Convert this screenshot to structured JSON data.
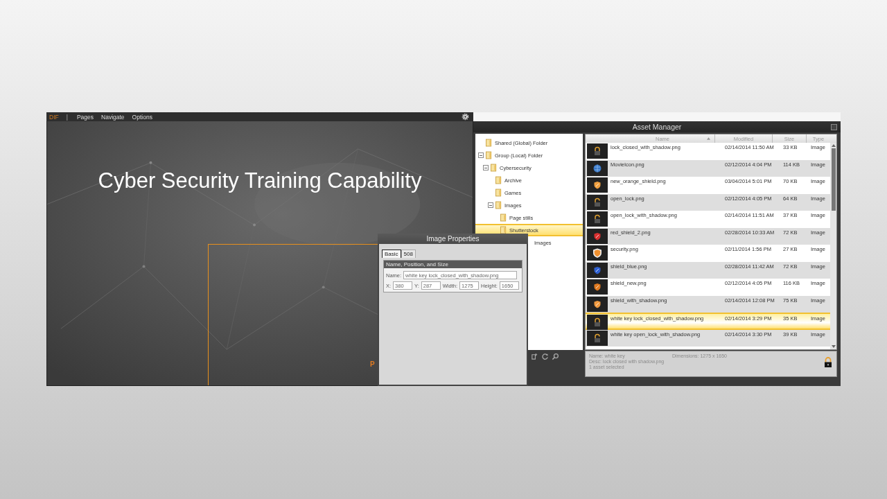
{
  "editor": {
    "menu": {
      "logo": "DIF",
      "separator": "|",
      "items": [
        "Pages",
        "Navigate",
        "Options"
      ]
    },
    "slide": {
      "title": "Cyber Security Training Capability",
      "partial_text": "P"
    }
  },
  "asset_manager": {
    "title": "Asset Manager",
    "tree": [
      {
        "label": "Shared (Global) Folder",
        "selected": false
      },
      {
        "label": "Group (Local) Folder",
        "expanded": true,
        "selected": false,
        "children": [
          {
            "label": "Cybersecurity",
            "expanded": true,
            "selected": false,
            "children": [
              {
                "label": "Archive",
                "selected": false
              },
              {
                "label": "Games",
                "selected": false
              },
              {
                "label": "Images",
                "expanded": true,
                "selected": false,
                "children": [
                  {
                    "label": "Page stills",
                    "selected": false
                  },
                  {
                    "label": "Shutterstock",
                    "selected": true
                  },
                  {
                    "label": "Images",
                    "selected": false,
                    "partly_hidden": true
                  }
                ]
              }
            ]
          }
        ]
      }
    ],
    "columns": [
      {
        "label": "Name",
        "sorted": true
      },
      {
        "label": "Modified",
        "sorted": false
      },
      {
        "label": "Size",
        "sorted": false
      },
      {
        "label": "Type",
        "sorted": false
      }
    ],
    "rows": [
      {
        "kind": "lock-closed",
        "name": "lock_closed_with_shadow.png",
        "modified": "02/14/2014 11:50 AM",
        "size": "33 KB",
        "type": "Image",
        "selected": false
      },
      {
        "kind": "globe",
        "name": "MovieIcon.png",
        "modified": "02/12/2014 4:04 PM",
        "size": "114 KB",
        "type": "Image",
        "selected": false
      },
      {
        "kind": "shield",
        "color": "#f0a040",
        "name": "new_orange_shield.png",
        "modified": "03/04/2014 5:01 PM",
        "size": "70 KB",
        "type": "Image",
        "selected": false
      },
      {
        "kind": "lock-open",
        "name": "open_lock.png",
        "modified": "02/12/2014 4:05 PM",
        "size": "64 KB",
        "type": "Image",
        "selected": false
      },
      {
        "kind": "lock-open",
        "name": "open_lock_with_shadow.png",
        "modified": "02/14/2014 11:51 AM",
        "size": "37 KB",
        "type": "Image",
        "selected": false
      },
      {
        "kind": "shield",
        "color": "#d83030",
        "name": "red_shield_2.png",
        "modified": "02/28/2014 10:33 AM",
        "size": "72 KB",
        "type": "Image",
        "selected": false
      },
      {
        "kind": "shield-large",
        "color": "#f09030",
        "name": "security.png",
        "modified": "02/11/2014 1:56 PM",
        "size": "27 KB",
        "type": "Image",
        "selected": false
      },
      {
        "kind": "shield",
        "color": "#3060d0",
        "name": "shield_blue.png",
        "modified": "02/28/2014 11:42 AM",
        "size": "72 KB",
        "type": "Image",
        "selected": false
      },
      {
        "kind": "shield",
        "color": "#e07a20",
        "name": "shield_new.png",
        "modified": "02/12/2014 4:05 PM",
        "size": "116 KB",
        "type": "Image",
        "selected": false
      },
      {
        "kind": "shield",
        "color": "#f09a40",
        "name": "shield_with_shadow.png",
        "modified": "02/14/2014 12:08 PM",
        "size": "75 KB",
        "type": "Image",
        "selected": false
      },
      {
        "kind": "lock-closed",
        "name": "white key lock_closed_with_shadow.png",
        "modified": "02/14/2014 3:29 PM",
        "size": "35 KB",
        "type": "Image",
        "selected": true
      },
      {
        "kind": "lock-open",
        "name": "white key open_lock_with_shadow.png",
        "modified": "02/14/2014 3:30 PM",
        "size": "39 KB",
        "type": "Image",
        "selected": false
      }
    ],
    "info": {
      "name": "Name: white key",
      "dimensions": "Dimensions: 1275 x 1650",
      "desc": "Desc: lock closed with shadow.png",
      "count": "1 asset selected"
    }
  },
  "dialog": {
    "title": "Image Properties",
    "tabs": [
      {
        "label": "Basic",
        "selected": true
      },
      {
        "label": "508",
        "selected": false
      }
    ],
    "group": "Name, Position, and Size",
    "name_field": {
      "label": "Name:",
      "value": "white key lock_closed_with_shadow.png"
    },
    "position_fields": [
      {
        "label": "X:",
        "value": "380"
      },
      {
        "label": "Y:",
        "value": "287"
      },
      {
        "label": "Width:",
        "value": "1275"
      },
      {
        "label": "Height:",
        "value": "1650"
      }
    ]
  }
}
